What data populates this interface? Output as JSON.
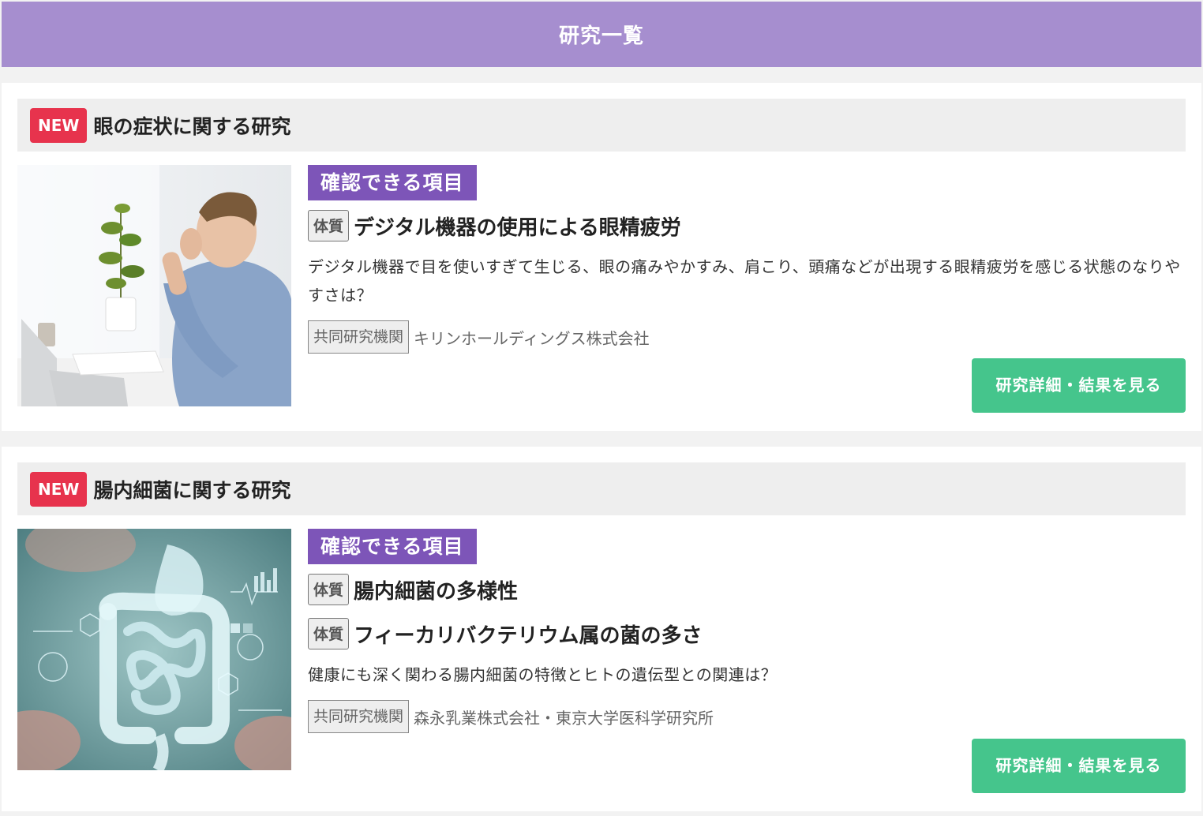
{
  "header": {
    "title": "研究一覧"
  },
  "studies": [
    {
      "badge": "NEW",
      "title": "眼の症状に関する研究",
      "image_icon": "man-with-eye-strain-photo",
      "check_label": "確認できる項目",
      "items": [
        {
          "tag": "体質",
          "text": "デジタル機器の使用による眼精疲労"
        }
      ],
      "description": "デジタル機器で目を使いすぎて生じる、眼の痛みやかすみ、肩こり、頭痛などが出現する眼精疲労を感じる状態のなりやすさは？",
      "org_label": "共同研究機関",
      "org_name": "キリンホールディングス株式会社",
      "button_label": "研究詳細・結果を見る"
    },
    {
      "badge": "NEW",
      "title": "腸内細菌に関する研究",
      "image_icon": "intestine-hologram-photo",
      "check_label": "確認できる項目",
      "items": [
        {
          "tag": "体質",
          "text": "腸内細菌の多様性"
        },
        {
          "tag": "体質",
          "text": "フィーカリバクテリウム属の菌の多さ"
        }
      ],
      "description": "健康にも深く関わる腸内細菌の特徴とヒトの遺伝型との関連は？",
      "org_label": "共同研究機関",
      "org_name": "森永乳業株式会社・東京大学医科学研究所",
      "button_label": "研究詳細・結果を見る"
    }
  ],
  "colors": {
    "header_bg": "#a68ecf",
    "new_badge": "#e7334d",
    "check_label_bg": "#7d55b8",
    "button_bg": "#45c58c"
  }
}
